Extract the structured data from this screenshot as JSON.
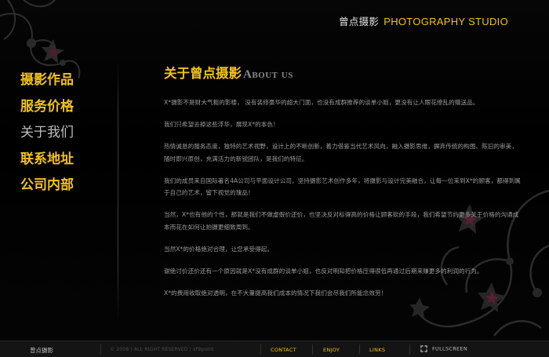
{
  "brand": {
    "name_cn": "曾点摄影",
    "name_en": "PHOTOGRAPHY STUDIO"
  },
  "nav": {
    "items": [
      {
        "label": "摄影作品"
      },
      {
        "label": "服务价格"
      },
      {
        "label": "关于我们",
        "active": true
      },
      {
        "label": "联系地址"
      },
      {
        "label": "公司内部"
      }
    ]
  },
  "main": {
    "title_cn": "关于曾点摄影",
    "title_en": "About us",
    "paragraphs": [
      "X*摄影不是财大气粗的影楼， 没有装修豪华的超大门面，也没有成群推荐的谈单小姐，更没有让人眼花缭乱的赠送品。",
      "我们只希望去掉这些浮华，展现X*的本色！",
      "热情诚恳的服务态度，独特的艺术视野，设计上的不断创新，着力借鉴当代艺术风向，融入摄影思维，摒弃传统的构图、陈旧的审美，随时即兴原创，充满活力的新锐团队，是我们的特征。",
      "我们的成员来自国际著名4A公司与平面设计公司，坚持摄影艺术创作多年，将摄影与设计完美融合，让每一位来到X*的顾客，都得到属于自己的艺术，留下视觉的瑰品！",
      "当然，X*也有他的个性，那就是我们不做虚假价还价，也坚决反对标得高的价格让顾客砍的手段，我们希望节约更多关于价格的沟通成本而花在如何让拍摄更细致周到。",
      "当然X*的价格绝对合理，让您承受得起。",
      "谢绝讨价还价还有一个原因就是X*没有成群的谈单小姐，也反对明知把价格压得很低再通过后期来赚更多的利润的行为。",
      "X*的费用收取绝对透明，在不大量提高我们成本的情况下我们会尽我们所能念效劳！"
    ]
  },
  "footer": {
    "brand": "曾点摄影",
    "copyright": "© 2008 | ALL RIGHT RESERVED | xf9point",
    "links": {
      "contact": "CONTACT",
      "enjoy": "ENJOY",
      "links": "LINKS"
    },
    "fullscreen": "FULLSCREEN"
  },
  "icons": [
    "flower-ornament-icon",
    "fullscreen-icon"
  ],
  "colors": {
    "accent": "#f2c21b",
    "background": "#000000",
    "body_text": "#9c9c9c",
    "active_nav": "#bdbdbd"
  }
}
